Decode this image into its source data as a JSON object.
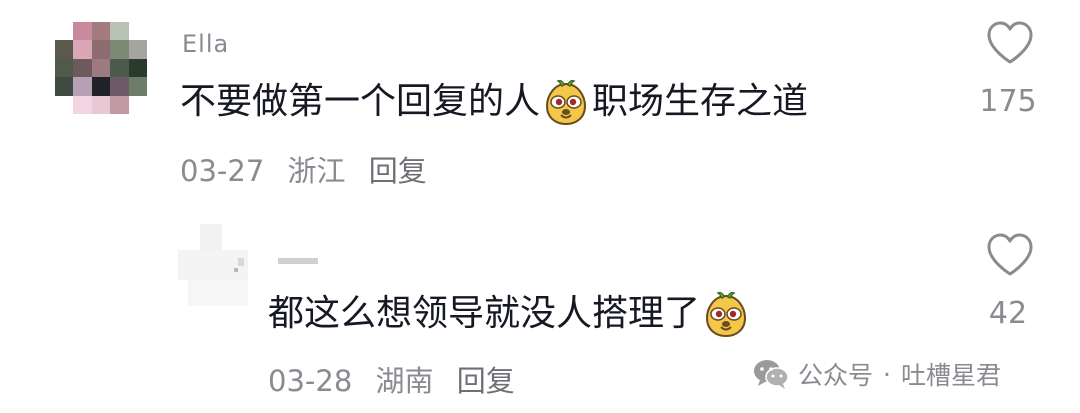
{
  "comments": [
    {
      "username": "Ella",
      "text_before_emoji": "不要做第一个回复的人",
      "emoji": "smirk-emoji",
      "text_after_emoji": "职场生存之道",
      "date": "03-27",
      "location": "浙江",
      "reply_label": "回复",
      "likes": "175"
    },
    {
      "username": "",
      "text_before_emoji": "都这么想领导就没人搭理了",
      "emoji": "smirk-emoji",
      "text_after_emoji": "",
      "date": "03-28",
      "location": "湖南",
      "reply_label": "回复",
      "likes": "42"
    }
  ],
  "watermark": {
    "source": "公众号",
    "separator": "·",
    "account": "吐槽星君"
  },
  "colors": {
    "text_primary": "#161823",
    "text_secondary": "#8a8b91",
    "emoji_body": "#f3c74a"
  }
}
